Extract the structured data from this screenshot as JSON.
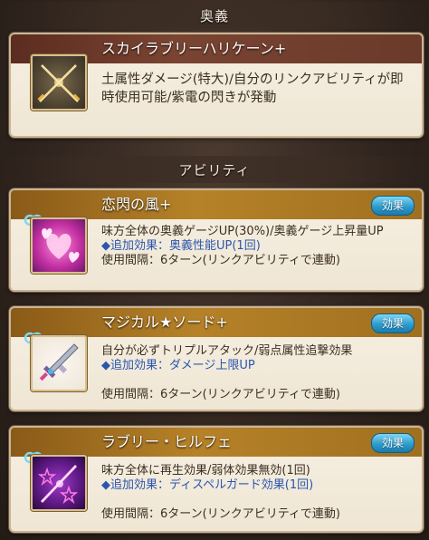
{
  "ougi_section": {
    "title": "奥義"
  },
  "ougi": {
    "name": "スカイラブリーハリケーン+",
    "description": "土属性ダメージ(特大)/自分のリンクアビリティが即時使用可能/紫電の閃きが発動"
  },
  "ability_section": {
    "title": "アビリティ"
  },
  "abilities": [
    {
      "name": "恋閃の風+",
      "button_label": "効果",
      "description": "味方全体の奥義ゲージUP(30%)/奥義ゲージ上昇量UP",
      "extra": "◆追加効果：奥義性能UP(1回)",
      "cooldown": "使用間隔：6ターン(リンクアビリティで連動)"
    },
    {
      "name": "マジカル★ソード+",
      "button_label": "効果",
      "description": "自分が必ずトリプルアタック/弱点属性追撃効果",
      "extra": "◆追加効果：ダメージ上限UP",
      "cooldown": "使用間隔：6ターン(リンクアビリティで連動)"
    },
    {
      "name": "ラブリー・ヒルフェ",
      "button_label": "効果",
      "description": "味方全体に再生効果/弱体効果無効(1回)",
      "extra": "◆追加効果：ディスペルガード効果(1回)",
      "cooldown": "使用間隔：6ターン(リンクアビリティで連動)"
    }
  ]
}
